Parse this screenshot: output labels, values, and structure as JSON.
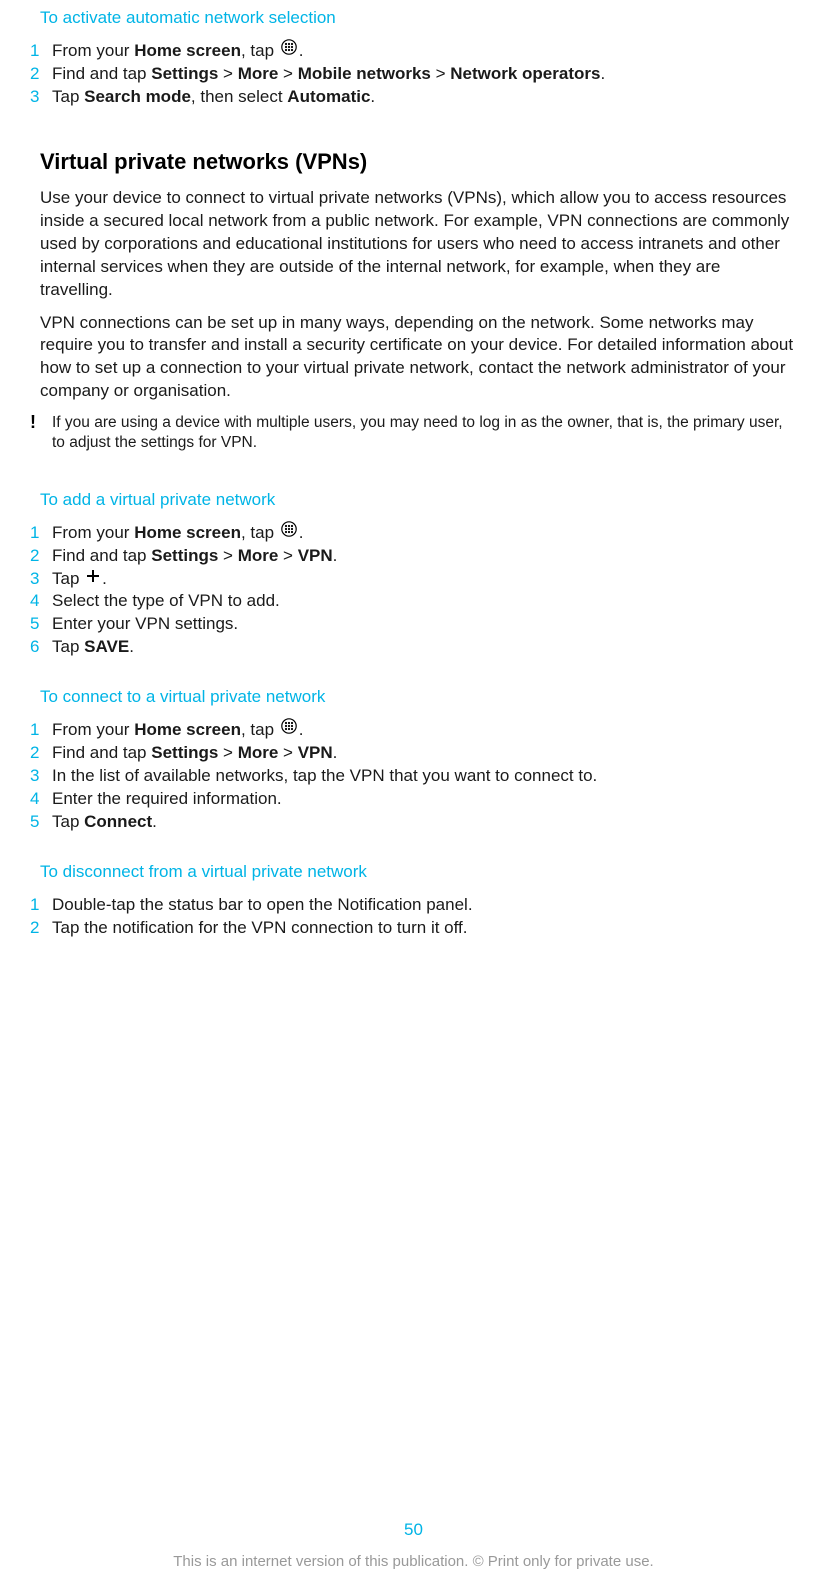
{
  "section1": {
    "title": "To activate automatic network selection",
    "steps": [
      {
        "n": "1",
        "parts": [
          "From your ",
          "Home screen",
          ", tap ",
          "ICON_APPS",
          "."
        ]
      },
      {
        "n": "2",
        "parts": [
          "Find and tap ",
          "Settings",
          " > ",
          "More",
          " > ",
          "Mobile networks",
          " > ",
          "Network operators",
          "."
        ]
      },
      {
        "n": "3",
        "parts": [
          "Tap ",
          "Search mode",
          ", then select ",
          "Automatic",
          "."
        ]
      }
    ]
  },
  "vpn": {
    "heading": "Virtual private networks (VPNs)",
    "para1": "Use your device to connect to virtual private networks (VPNs), which allow you to access resources inside a secured local network from a public network. For example, VPN connections are commonly used by corporations and educational institutions for users who need to access intranets and other internal services when they are outside of the internal network, for example, when they are travelling.",
    "para2": "VPN connections can be set up in many ways, depending on the network. Some networks may require you to transfer and install a security certificate on your device. For detailed information about how to set up a connection to your virtual private network, contact the network administrator of your company or organisation.",
    "note": "If you are using a device with multiple users, you may need to log in as the owner, that is, the primary user, to adjust the settings for VPN."
  },
  "section2": {
    "title": "To add a virtual private network",
    "steps": [
      {
        "n": "1",
        "parts": [
          "From your ",
          "Home screen",
          ", tap ",
          "ICON_APPS",
          "."
        ]
      },
      {
        "n": "2",
        "parts": [
          "Find and tap ",
          "Settings",
          " > ",
          "More",
          " > ",
          "VPN",
          "."
        ]
      },
      {
        "n": "3",
        "parts": [
          "Tap ",
          "ICON_PLUS",
          "."
        ]
      },
      {
        "n": "4",
        "parts": [
          "Select the type of VPN to add."
        ]
      },
      {
        "n": "5",
        "parts": [
          "Enter your VPN settings."
        ]
      },
      {
        "n": "6",
        "parts": [
          "Tap ",
          "SAVE",
          "."
        ]
      }
    ]
  },
  "section3": {
    "title": "To connect to a virtual private network",
    "steps": [
      {
        "n": "1",
        "parts": [
          "From your ",
          "Home screen",
          ", tap ",
          "ICON_APPS",
          "."
        ]
      },
      {
        "n": "2",
        "parts": [
          "Find and tap ",
          "Settings",
          " > ",
          "More",
          " > ",
          "VPN",
          "."
        ]
      },
      {
        "n": "3",
        "parts": [
          "In the list of available networks, tap the VPN that you want to connect to."
        ]
      },
      {
        "n": "4",
        "parts": [
          "Enter the required information."
        ]
      },
      {
        "n": "5",
        "parts": [
          "Tap ",
          "Connect",
          "."
        ]
      }
    ]
  },
  "section4": {
    "title": "To disconnect from a virtual private network",
    "steps": [
      {
        "n": "1",
        "parts": [
          "Double-tap the status bar to open the Notification panel."
        ]
      },
      {
        "n": "2",
        "parts": [
          "Tap the notification for the VPN connection to turn it off."
        ]
      }
    ]
  },
  "page_number": "50",
  "footer": "This is an internet version of this publication. © Print only for private use."
}
